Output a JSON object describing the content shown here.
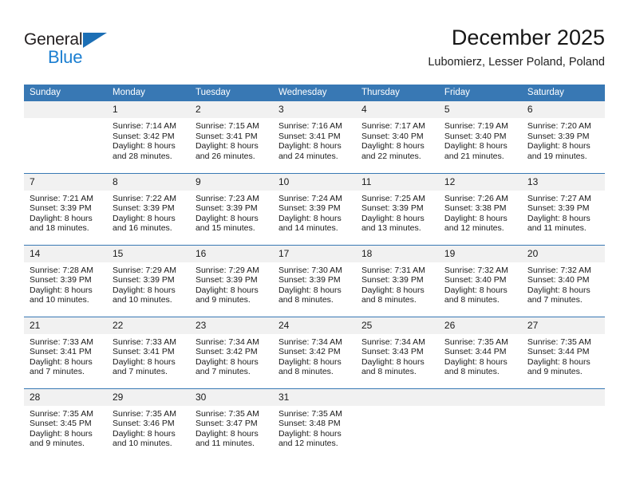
{
  "brand": {
    "name_part1": "General",
    "name_part2": "Blue",
    "triangle_icon": "triangle-icon",
    "color_dark": "#231f20",
    "color_blue": "#1c7fd1"
  },
  "header": {
    "title": "December 2025",
    "subtitle": "Lubomierz, Lesser Poland, Poland"
  },
  "theme": {
    "header_bg": "#3878b4",
    "header_text": "#ffffff",
    "daynum_bg": "#f1f1f1",
    "rule_color": "#3878b4"
  },
  "weekdays": [
    "Sunday",
    "Monday",
    "Tuesday",
    "Wednesday",
    "Thursday",
    "Friday",
    "Saturday"
  ],
  "weeks": [
    [
      {
        "day": "",
        "sunrise": "",
        "sunset": "",
        "daylight1": "",
        "daylight2": ""
      },
      {
        "day": "1",
        "sunrise": "Sunrise: 7:14 AM",
        "sunset": "Sunset: 3:42 PM",
        "daylight1": "Daylight: 8 hours",
        "daylight2": "and 28 minutes."
      },
      {
        "day": "2",
        "sunrise": "Sunrise: 7:15 AM",
        "sunset": "Sunset: 3:41 PM",
        "daylight1": "Daylight: 8 hours",
        "daylight2": "and 26 minutes."
      },
      {
        "day": "3",
        "sunrise": "Sunrise: 7:16 AM",
        "sunset": "Sunset: 3:41 PM",
        "daylight1": "Daylight: 8 hours",
        "daylight2": "and 24 minutes."
      },
      {
        "day": "4",
        "sunrise": "Sunrise: 7:17 AM",
        "sunset": "Sunset: 3:40 PM",
        "daylight1": "Daylight: 8 hours",
        "daylight2": "and 22 minutes."
      },
      {
        "day": "5",
        "sunrise": "Sunrise: 7:19 AM",
        "sunset": "Sunset: 3:40 PM",
        "daylight1": "Daylight: 8 hours",
        "daylight2": "and 21 minutes."
      },
      {
        "day": "6",
        "sunrise": "Sunrise: 7:20 AM",
        "sunset": "Sunset: 3:39 PM",
        "daylight1": "Daylight: 8 hours",
        "daylight2": "and 19 minutes."
      }
    ],
    [
      {
        "day": "7",
        "sunrise": "Sunrise: 7:21 AM",
        "sunset": "Sunset: 3:39 PM",
        "daylight1": "Daylight: 8 hours",
        "daylight2": "and 18 minutes."
      },
      {
        "day": "8",
        "sunrise": "Sunrise: 7:22 AM",
        "sunset": "Sunset: 3:39 PM",
        "daylight1": "Daylight: 8 hours",
        "daylight2": "and 16 minutes."
      },
      {
        "day": "9",
        "sunrise": "Sunrise: 7:23 AM",
        "sunset": "Sunset: 3:39 PM",
        "daylight1": "Daylight: 8 hours",
        "daylight2": "and 15 minutes."
      },
      {
        "day": "10",
        "sunrise": "Sunrise: 7:24 AM",
        "sunset": "Sunset: 3:39 PM",
        "daylight1": "Daylight: 8 hours",
        "daylight2": "and 14 minutes."
      },
      {
        "day": "11",
        "sunrise": "Sunrise: 7:25 AM",
        "sunset": "Sunset: 3:39 PM",
        "daylight1": "Daylight: 8 hours",
        "daylight2": "and 13 minutes."
      },
      {
        "day": "12",
        "sunrise": "Sunrise: 7:26 AM",
        "sunset": "Sunset: 3:38 PM",
        "daylight1": "Daylight: 8 hours",
        "daylight2": "and 12 minutes."
      },
      {
        "day": "13",
        "sunrise": "Sunrise: 7:27 AM",
        "sunset": "Sunset: 3:39 PM",
        "daylight1": "Daylight: 8 hours",
        "daylight2": "and 11 minutes."
      }
    ],
    [
      {
        "day": "14",
        "sunrise": "Sunrise: 7:28 AM",
        "sunset": "Sunset: 3:39 PM",
        "daylight1": "Daylight: 8 hours",
        "daylight2": "and 10 minutes."
      },
      {
        "day": "15",
        "sunrise": "Sunrise: 7:29 AM",
        "sunset": "Sunset: 3:39 PM",
        "daylight1": "Daylight: 8 hours",
        "daylight2": "and 10 minutes."
      },
      {
        "day": "16",
        "sunrise": "Sunrise: 7:29 AM",
        "sunset": "Sunset: 3:39 PM",
        "daylight1": "Daylight: 8 hours",
        "daylight2": "and 9 minutes."
      },
      {
        "day": "17",
        "sunrise": "Sunrise: 7:30 AM",
        "sunset": "Sunset: 3:39 PM",
        "daylight1": "Daylight: 8 hours",
        "daylight2": "and 8 minutes."
      },
      {
        "day": "18",
        "sunrise": "Sunrise: 7:31 AM",
        "sunset": "Sunset: 3:39 PM",
        "daylight1": "Daylight: 8 hours",
        "daylight2": "and 8 minutes."
      },
      {
        "day": "19",
        "sunrise": "Sunrise: 7:32 AM",
        "sunset": "Sunset: 3:40 PM",
        "daylight1": "Daylight: 8 hours",
        "daylight2": "and 8 minutes."
      },
      {
        "day": "20",
        "sunrise": "Sunrise: 7:32 AM",
        "sunset": "Sunset: 3:40 PM",
        "daylight1": "Daylight: 8 hours",
        "daylight2": "and 7 minutes."
      }
    ],
    [
      {
        "day": "21",
        "sunrise": "Sunrise: 7:33 AM",
        "sunset": "Sunset: 3:41 PM",
        "daylight1": "Daylight: 8 hours",
        "daylight2": "and 7 minutes."
      },
      {
        "day": "22",
        "sunrise": "Sunrise: 7:33 AM",
        "sunset": "Sunset: 3:41 PM",
        "daylight1": "Daylight: 8 hours",
        "daylight2": "and 7 minutes."
      },
      {
        "day": "23",
        "sunrise": "Sunrise: 7:34 AM",
        "sunset": "Sunset: 3:42 PM",
        "daylight1": "Daylight: 8 hours",
        "daylight2": "and 7 minutes."
      },
      {
        "day": "24",
        "sunrise": "Sunrise: 7:34 AM",
        "sunset": "Sunset: 3:42 PM",
        "daylight1": "Daylight: 8 hours",
        "daylight2": "and 8 minutes."
      },
      {
        "day": "25",
        "sunrise": "Sunrise: 7:34 AM",
        "sunset": "Sunset: 3:43 PM",
        "daylight1": "Daylight: 8 hours",
        "daylight2": "and 8 minutes."
      },
      {
        "day": "26",
        "sunrise": "Sunrise: 7:35 AM",
        "sunset": "Sunset: 3:44 PM",
        "daylight1": "Daylight: 8 hours",
        "daylight2": "and 8 minutes."
      },
      {
        "day": "27",
        "sunrise": "Sunrise: 7:35 AM",
        "sunset": "Sunset: 3:44 PM",
        "daylight1": "Daylight: 8 hours",
        "daylight2": "and 9 minutes."
      }
    ],
    [
      {
        "day": "28",
        "sunrise": "Sunrise: 7:35 AM",
        "sunset": "Sunset: 3:45 PM",
        "daylight1": "Daylight: 8 hours",
        "daylight2": "and 9 minutes."
      },
      {
        "day": "29",
        "sunrise": "Sunrise: 7:35 AM",
        "sunset": "Sunset: 3:46 PM",
        "daylight1": "Daylight: 8 hours",
        "daylight2": "and 10 minutes."
      },
      {
        "day": "30",
        "sunrise": "Sunrise: 7:35 AM",
        "sunset": "Sunset: 3:47 PM",
        "daylight1": "Daylight: 8 hours",
        "daylight2": "and 11 minutes."
      },
      {
        "day": "31",
        "sunrise": "Sunrise: 7:35 AM",
        "sunset": "Sunset: 3:48 PM",
        "daylight1": "Daylight: 8 hours",
        "daylight2": "and 12 minutes."
      },
      {
        "day": "",
        "sunrise": "",
        "sunset": "",
        "daylight1": "",
        "daylight2": ""
      },
      {
        "day": "",
        "sunrise": "",
        "sunset": "",
        "daylight1": "",
        "daylight2": ""
      },
      {
        "day": "",
        "sunrise": "",
        "sunset": "",
        "daylight1": "",
        "daylight2": ""
      }
    ]
  ]
}
